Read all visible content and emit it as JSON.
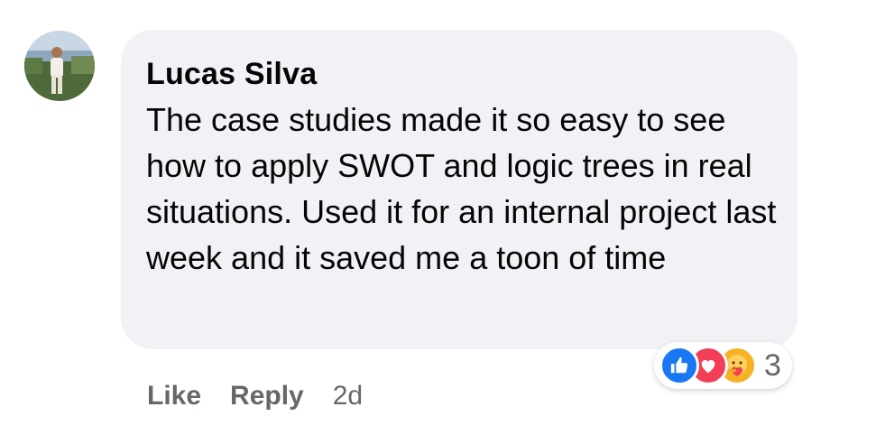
{
  "comment": {
    "author": "Lucas Silva",
    "text": "The case studies made it so easy to see how to apply SWOT and logic trees in real situations. Used it for an internal project last week and it saved me a toon of time",
    "avatar_icon": "profile-photo"
  },
  "reactions": {
    "icons": [
      "like-icon",
      "love-icon",
      "care-icon"
    ],
    "count": "3",
    "colors": {
      "like": "#1877f2",
      "love": "#f33e58",
      "care": "#f7b125"
    }
  },
  "actions": {
    "like_label": "Like",
    "reply_label": "Reply",
    "timestamp": "2d"
  },
  "colors": {
    "bubble_bg": "#f0f2f5",
    "secondary_text": "#65676b",
    "primary_text": "#050505"
  }
}
